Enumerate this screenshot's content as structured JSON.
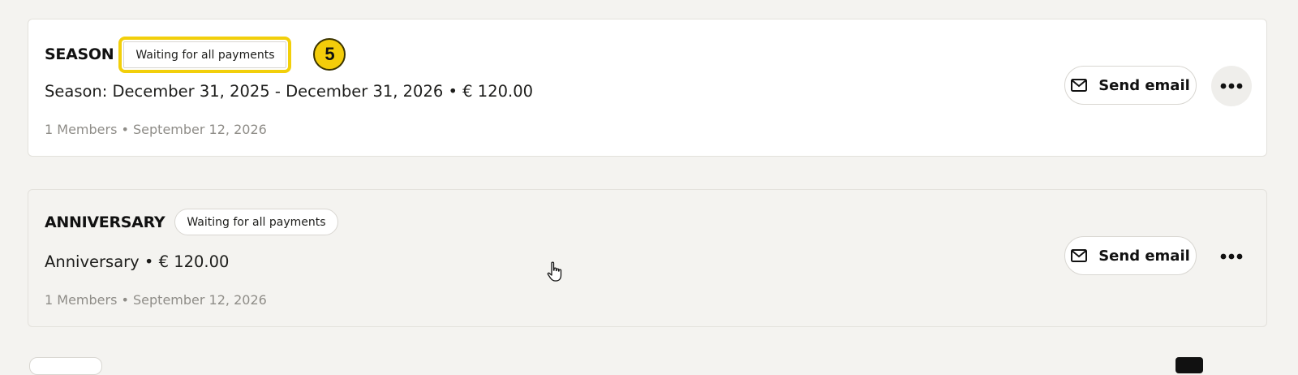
{
  "cards": [
    {
      "plan_name": "SEASON",
      "status": "Waiting for all payments",
      "step_marker": "5",
      "description": "Season: December 31, 2025 - December 31, 2026 • € 120.00",
      "meta": "1 Members • September 12, 2026",
      "send_email_label": "Send email"
    },
    {
      "plan_name": "ANNIVERSARY",
      "status": "Waiting for all payments",
      "description": "Anniversary • € 120.00",
      "meta": "1 Members • September 12, 2026",
      "send_email_label": "Send email"
    }
  ],
  "colors": {
    "highlight": "#f2cf0a",
    "background": "#f4f3f0",
    "muted_text": "#8f8d88"
  },
  "icons": [
    "mail-icon",
    "more-horizontal-icon",
    "hand-pointer-cursor-icon"
  ]
}
